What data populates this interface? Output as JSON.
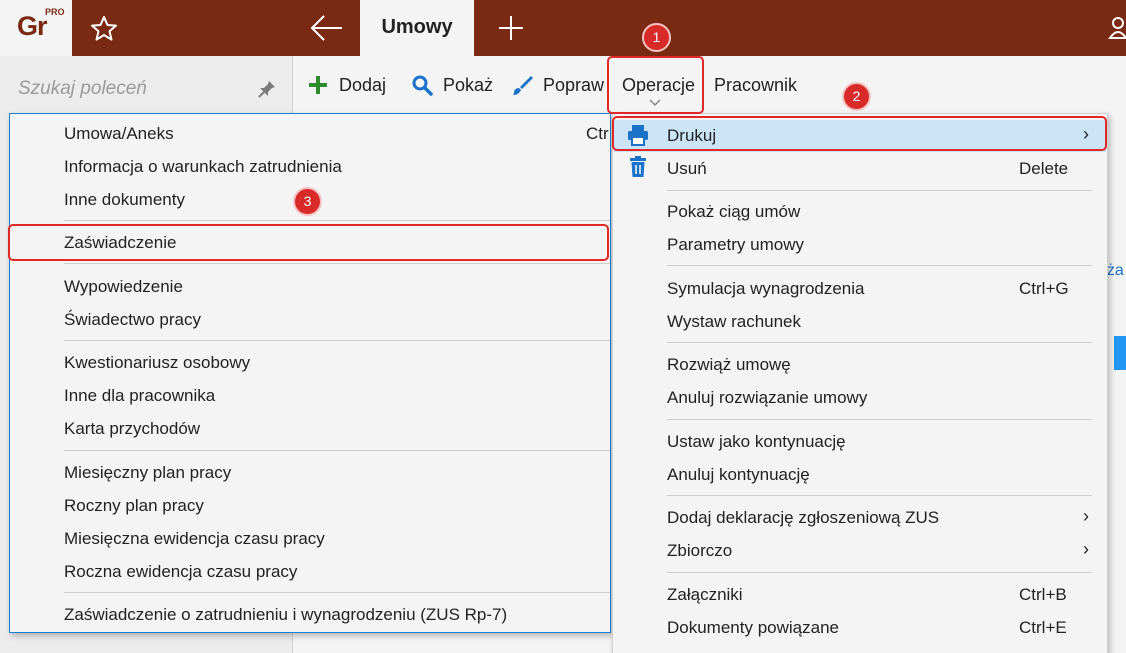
{
  "app": {
    "logo": "Gr",
    "logo_badge": "PRO",
    "active_tab": "Umowy"
  },
  "search": {
    "placeholder": "Szukaj poleceń"
  },
  "toolbar": {
    "add": "Dodaj",
    "show": "Pokaż",
    "edit": "Popraw",
    "operations": "Operacje",
    "employee": "Pracownik"
  },
  "background": {
    "partial_text": "eża"
  },
  "dropdown": {
    "print": "Drukuj",
    "delete": "Usuń",
    "delete_shortcut": "Delete",
    "show_chain": "Pokaż ciąg umów",
    "contract_params": "Parametry umowy",
    "salary_simulation": "Symulacja wynagrodzenia",
    "salary_simulation_shortcut": "Ctrl+G",
    "issue_bill": "Wystaw rachunek",
    "terminate": "Rozwiąż umowę",
    "cancel_termination": "Anuluj rozwiązanie umowy",
    "set_continuation": "Ustaw jako kontynuację",
    "cancel_continuation": "Anuluj kontynuację",
    "add_zus_declaration": "Dodaj deklarację zgłoszeniową ZUS",
    "collective": "Zbiorczo",
    "attachments": "Załączniki",
    "attachments_shortcut": "Ctrl+B",
    "related_documents": "Dokumenty powiązane",
    "related_documents_shortcut": "Ctrl+E",
    "arrow": "›"
  },
  "submenu": {
    "contract_annex": "Umowa/Aneks",
    "contract_annex_shortcut": "Ctr",
    "employment_conditions": "Informacja o warunkach zatrudnienia",
    "other_documents": "Inne dokumenty",
    "certificate": "Zaświadczenie",
    "termination_notice": "Wypowiedzenie",
    "work_certificate": "Świadectwo pracy",
    "personal_questionnaire": "Kwestionariusz osobowy",
    "other_for_employee": "Inne dla pracownika",
    "income_card": "Karta przychodów",
    "monthly_work_plan": "Miesięczny plan pracy",
    "yearly_work_plan": "Roczny plan pracy",
    "monthly_time_record": "Miesięczna ewidencja czasu pracy",
    "yearly_time_record": "Roczna ewidencja czasu pracy",
    "zus_rp7": "Zaświadczenie o zatrudnieniu i wynagrodzeniu (ZUS Rp-7)"
  },
  "annotations": {
    "badge_1": "1",
    "badge_2": "2",
    "badge_3": "3"
  },
  "colors": {
    "titlebar": "#7a2a12",
    "highlight": "#cce4f7",
    "annotation_red": "#e02828",
    "add_green": "#2e8b2e",
    "search_blue": "#1a73c8"
  }
}
